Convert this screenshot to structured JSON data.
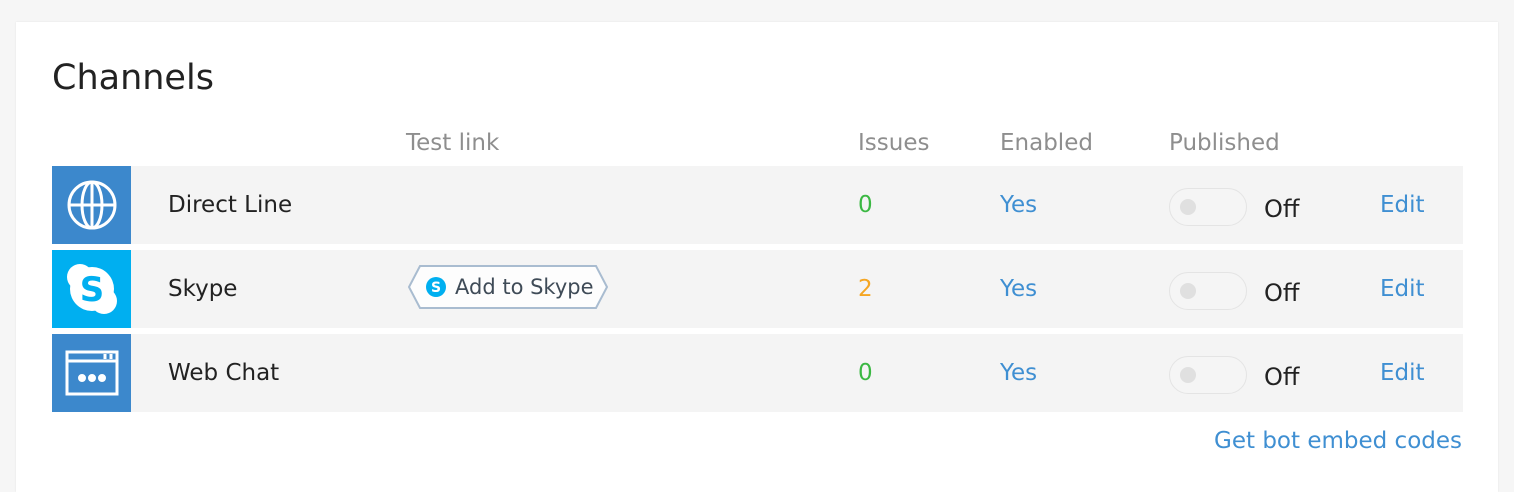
{
  "panel": {
    "title": "Channels",
    "columns": {
      "test_link": "Test link",
      "issues": "Issues",
      "enabled": "Enabled",
      "published": "Published"
    },
    "channels": [
      {
        "name": "Direct Line",
        "icon": "globe-icon",
        "icon_bg": "#3c88cc",
        "test_link": "",
        "issues": "0",
        "issues_color": "#3bb843",
        "enabled": "Yes",
        "published": "Off",
        "edit": "Edit"
      },
      {
        "name": "Skype",
        "icon": "skype-icon",
        "icon_bg": "#00aff0",
        "test_link": "Add to Skype",
        "issues": "2",
        "issues_color": "#f5a623",
        "enabled": "Yes",
        "published": "Off",
        "edit": "Edit"
      },
      {
        "name": "Web Chat",
        "icon": "webchat-icon",
        "icon_bg": "#3c88cc",
        "test_link": "",
        "issues": "0",
        "issues_color": "#3bb843",
        "enabled": "Yes",
        "published": "Off",
        "edit": "Edit"
      }
    ],
    "embed_link": "Get bot embed codes"
  },
  "colors": {
    "link": "#3f8fd2",
    "row_bg": "#f4f4f4",
    "header_text": "#8e8e8e"
  }
}
